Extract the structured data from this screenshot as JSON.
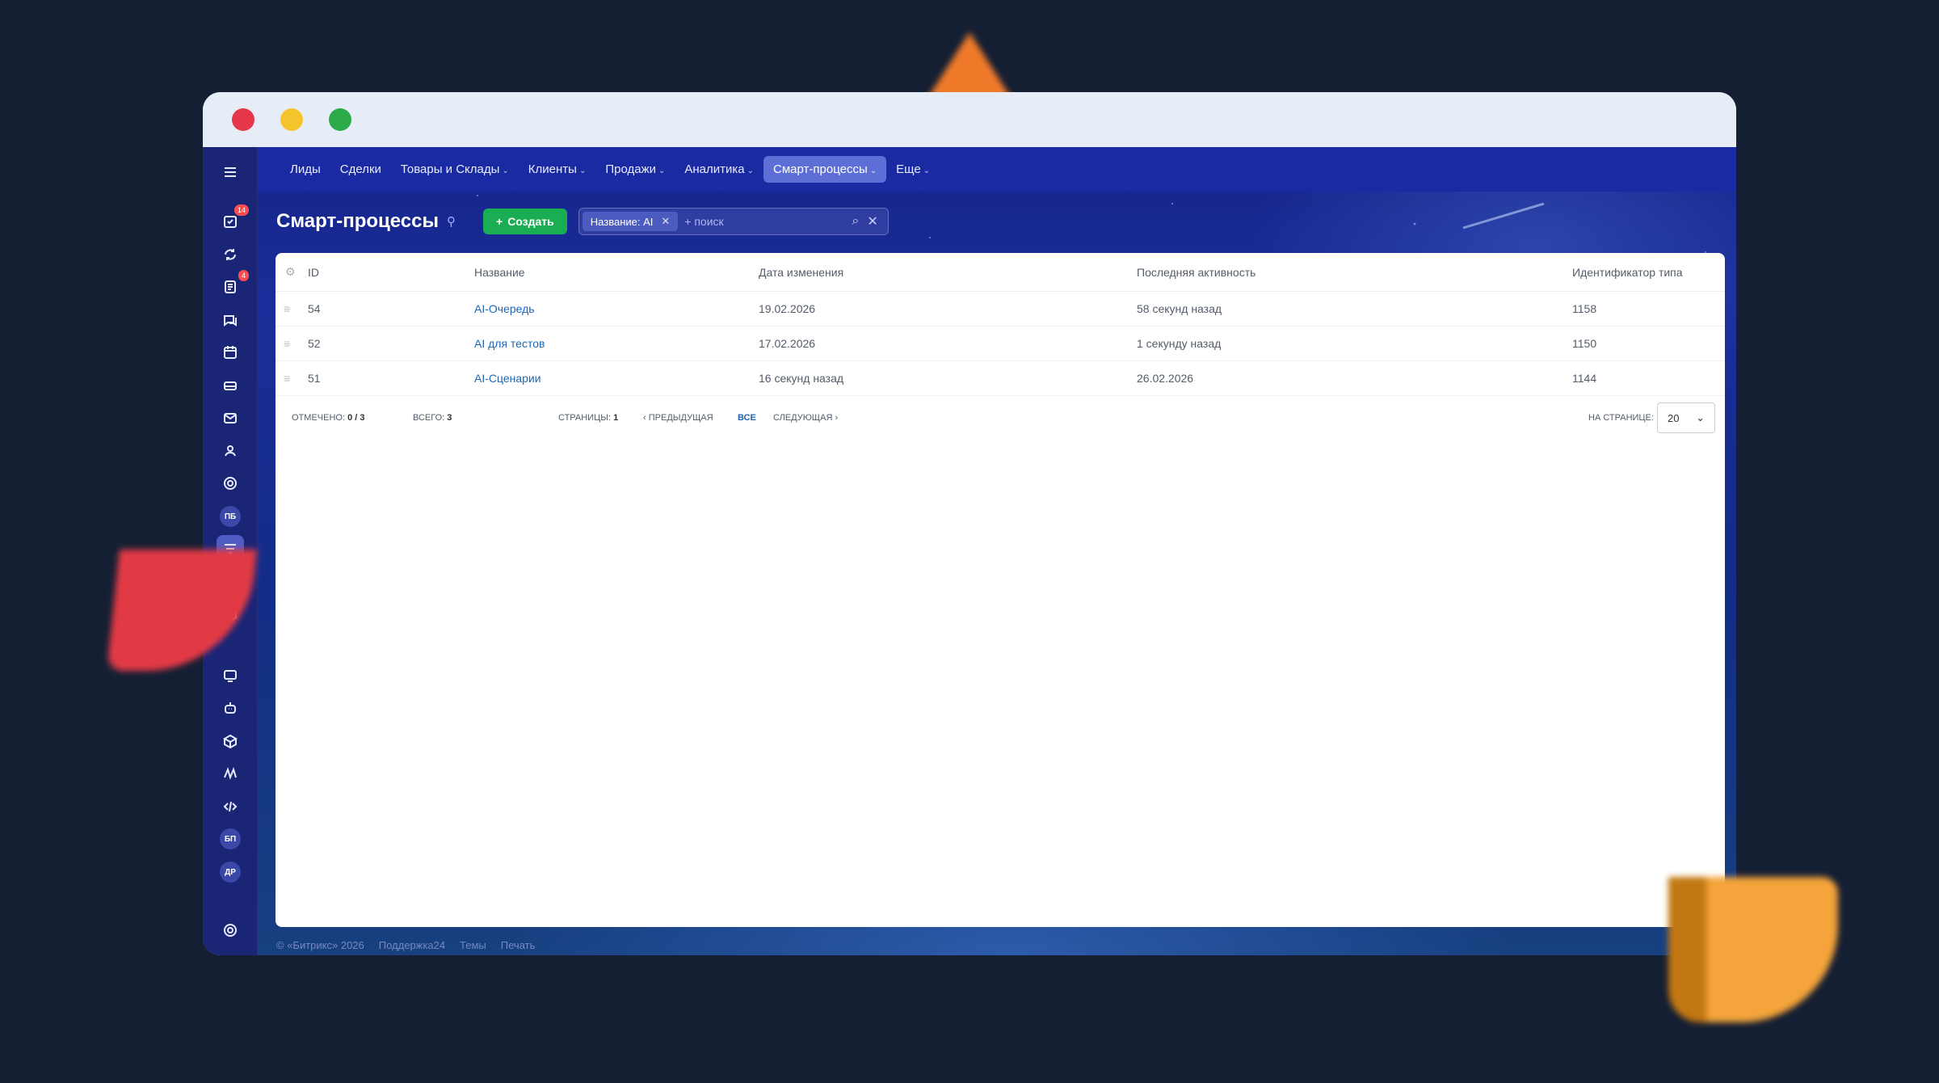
{
  "nav": {
    "items": [
      {
        "label": "Лиды",
        "chevron": false,
        "active": false
      },
      {
        "label": "Сделки",
        "chevron": false,
        "active": false
      },
      {
        "label": "Товары и Склады",
        "chevron": true,
        "active": false
      },
      {
        "label": "Клиенты",
        "chevron": true,
        "active": false
      },
      {
        "label": "Продажи",
        "chevron": true,
        "active": false
      },
      {
        "label": "Аналитика",
        "chevron": true,
        "active": false
      },
      {
        "label": "Смарт-процессы",
        "chevron": true,
        "active": true
      },
      {
        "label": "Еще",
        "chevron": true,
        "active": false
      }
    ]
  },
  "rail": {
    "badges": {
      "tasks": "14",
      "feed": "4"
    },
    "circles": {
      "pb": "ПБ",
      "bp": "БП",
      "dr": "ДР"
    }
  },
  "page": {
    "title": "Смарт-процессы",
    "create_label": "Создать",
    "filter_tag": "Название: AI",
    "search_placeholder": "+ поиск"
  },
  "grid": {
    "columns": {
      "id": "ID",
      "name": "Название",
      "date": "Дата изменения",
      "activity": "Последняя активность",
      "type_id": "Идентификатор типа"
    },
    "rows": [
      {
        "id": "54",
        "name": "AI-Очередь",
        "date": "19.02.2026",
        "activity": "58 секунд назад",
        "type_id": "1158"
      },
      {
        "id": "52",
        "name": "AI для тестов",
        "date": "17.02.2026",
        "activity": "1 секунду назад",
        "type_id": "1150"
      },
      {
        "id": "51",
        "name": "AI-Сценарии",
        "date": "16 секунд назад",
        "activity": "26.02.2026",
        "type_id": "1144"
      }
    ],
    "footer": {
      "selected_label": "Отмечено:",
      "selected_value": "0 / 3",
      "total_label": "Всего:",
      "total_value": "3",
      "pages_label": "Страницы:",
      "pages_value": "1",
      "prev_label": "Предыдущая",
      "all_label": "Все",
      "next_label": "Следующая",
      "per_page_label": "На странице:",
      "per_page_value": "20"
    }
  },
  "footer": {
    "copyright": "© «Битрикс» 2026",
    "support": "Поддержка24",
    "themes": "Темы",
    "print": "Печать"
  }
}
